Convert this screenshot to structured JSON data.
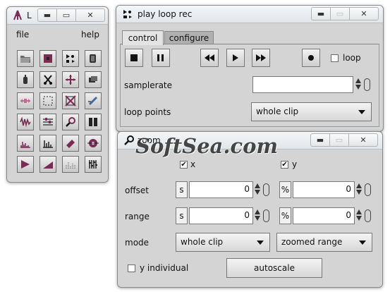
{
  "palette": {
    "title": "L",
    "menu": {
      "file": "file",
      "help": "help"
    },
    "tools": [
      "open-folder-icon",
      "record-square-icon",
      "play-loop-rec-icon",
      "clip-icon",
      "clip-small-icon",
      "cut-icon",
      "move-icon",
      "layers-icon",
      "stretch-icon",
      "selection-icon",
      "no-selection-icon",
      "pen-icon",
      "waveform-icon",
      "filter-icon",
      "search-icon",
      "columns-icon",
      "spectrum-icon",
      "histogram-icon",
      "eraser-icon",
      "target-icon",
      "play-arrow-icon",
      "ramp-icon",
      "bars-icon",
      "mixer-icon"
    ]
  },
  "player": {
    "title": "play loop rec",
    "tabs": [
      "control",
      "configure"
    ],
    "loop_label": "loop",
    "samplerate_label": "samplerate",
    "samplerate_value": "",
    "loop_points_label": "loop points",
    "loop_points_value": "whole clip"
  },
  "zoom": {
    "title": "zoom",
    "x_label": "x",
    "y_label": "y",
    "offset_label": "offset",
    "range_label": "range",
    "mode_label": "mode",
    "unit_s": "s",
    "unit_pct": "%",
    "offset_x": "0",
    "offset_y": "0",
    "range_x": "0",
    "range_y": "0",
    "mode_x": "whole clip",
    "mode_y": "zoomed range",
    "y_individual_label": "y individual",
    "autoscale_label": "autoscale"
  },
  "watermark": "SoftSea.com",
  "colors": {
    "window_bg": "#d4d4d4",
    "icon_accent": "#7a2a55"
  }
}
